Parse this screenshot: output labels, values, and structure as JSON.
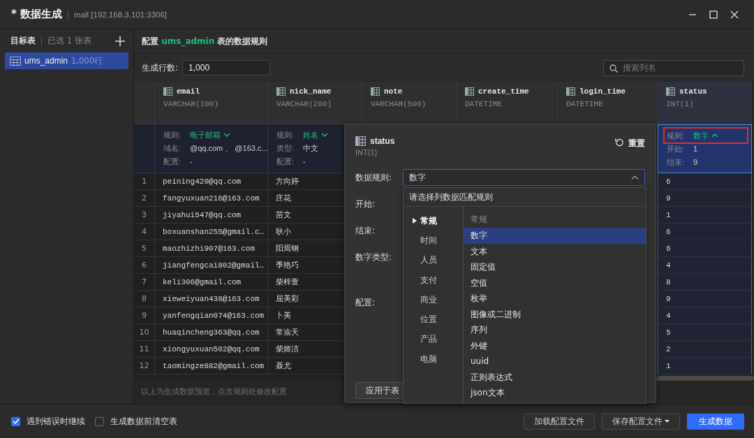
{
  "window": {
    "title": "* 数据生成",
    "connection": "mall [192.168.3.101:3306]"
  },
  "sidebar": {
    "title": "目标表",
    "selected_count": "已选 1 张表",
    "items": [
      {
        "name": "ums_admin",
        "rows": "1,000行",
        "selected": true
      }
    ]
  },
  "main": {
    "heading_prefix": "配置",
    "heading_table": "ums_admin",
    "heading_suffix": "表的数据规则"
  },
  "row_count": {
    "label": "生成行数:",
    "value": "1,000"
  },
  "search": {
    "placeholder": "搜索列名"
  },
  "row_numbers": [
    "1",
    "2",
    "3",
    "4",
    "5",
    "6",
    "7",
    "8",
    "9",
    "10",
    "11",
    "12"
  ],
  "columns": [
    {
      "name": "email",
      "type": "VARCHAR(100)",
      "selected": false,
      "rule": [
        {
          "label": "规则:",
          "value": "电子邮箱",
          "kind": "rule",
          "expanded": false,
          "marked": false
        },
        {
          "label": "域名:",
          "value": "@qq.com 、 @163.c…",
          "kind": "param"
        },
        {
          "label": "配置:",
          "value": "-",
          "kind": "param"
        }
      ],
      "cells": [
        "peining420@qq.com",
        "fangyuxuan216@163.com",
        "jiyahui547@qq.com",
        "boxuanshan255@gmail.c…",
        "maozhizhi907@163.com",
        "jiangfengcai802@gmail…",
        "keli306@gmail.com",
        "xieweiyuan438@163.com",
        "yanfengqian074@163.com",
        "huaqincheng363@qq.com",
        "xiongyuxuan502@qq.com",
        "taomingze882@gmail.com"
      ]
    },
    {
      "name": "nick_name",
      "type": "VARCHAR(200)",
      "selected": false,
      "rule": [
        {
          "label": "规则:",
          "value": "姓名",
          "kind": "rule",
          "expanded": false,
          "marked": false
        },
        {
          "label": "类型:",
          "value": "中文",
          "kind": "param"
        },
        {
          "label": "配置:",
          "value": "-",
          "kind": "param"
        }
      ],
      "cells": [
        "方向婷",
        "庄花",
        "苗文",
        "耿小",
        "阳焉钢",
        "季艳巧",
        "柴梓萱",
        "屈美彩",
        "卜美",
        "常渝天",
        "柴姬洁",
        "聂尤"
      ]
    },
    {
      "name": "note",
      "type": "VARCHAR(500)",
      "selected": false
    },
    {
      "name": "create_time",
      "type": "DATETIME",
      "selected": false
    },
    {
      "name": "login_time",
      "type": "DATETIME",
      "selected": false
    },
    {
      "name": "status",
      "type": "INT(1)",
      "selected": true,
      "rule": [
        {
          "label": "规则:",
          "value": "数字",
          "kind": "rule",
          "expanded": true,
          "marked": true
        },
        {
          "label": "开始:",
          "value": "1",
          "kind": "param"
        },
        {
          "label": "结束:",
          "value": "9",
          "kind": "param"
        }
      ],
      "cells": [
        "6",
        "9",
        "1",
        "6",
        "6",
        "4",
        "8",
        "9",
        "4",
        "5",
        "2",
        "1"
      ]
    }
  ],
  "preview_note": "以上为生成数据预览，点击规则处修改配置",
  "popover": {
    "column": "status",
    "type": "INT(1)",
    "reset": "重置",
    "fields": [
      {
        "label": "数据规则:",
        "kind": "select",
        "value": "数字",
        "expanded": true
      },
      {
        "label": "开始:",
        "kind": "label"
      },
      {
        "label": "结束:",
        "kind": "label"
      },
      {
        "label": "数字类型:",
        "kind": "label"
      },
      {
        "label": "配置:",
        "kind": "label"
      }
    ],
    "apply_button": "应用于表",
    "dropdown": {
      "header": "请选择列数据匹配规则",
      "categories": [
        {
          "label": "常规",
          "selected": true
        },
        {
          "label": "时间",
          "selected": false
        },
        {
          "label": "人员",
          "selected": false
        },
        {
          "label": "支付",
          "selected": false
        },
        {
          "label": "商业",
          "selected": false
        },
        {
          "label": "位置",
          "selected": false
        },
        {
          "label": "产品",
          "selected": false
        },
        {
          "label": "电脑",
          "selected": false
        }
      ],
      "group": "常规",
      "rules": [
        {
          "label": "数字",
          "selected": true
        },
        {
          "label": "文本",
          "selected": false
        },
        {
          "label": "固定值",
          "selected": false
        },
        {
          "label": "空值",
          "selected": false
        },
        {
          "label": "枚举",
          "selected": false
        },
        {
          "label": "图像或二进制",
          "selected": false
        },
        {
          "label": "序列",
          "selected": false
        },
        {
          "label": "外键",
          "selected": false
        },
        {
          "label": "uuid",
          "selected": false
        },
        {
          "label": "正则表达式",
          "selected": false
        },
        {
          "label": "json文本",
          "selected": false
        }
      ]
    }
  },
  "footer": {
    "options": [
      {
        "label": "遇到错误时继续",
        "checked": true
      },
      {
        "label": "生成数据前清空表",
        "checked": false
      }
    ],
    "buttons": [
      {
        "label": "加载配置文件",
        "kind": "default"
      },
      {
        "label": "保存配置文件",
        "kind": "dropdown"
      },
      {
        "label": "生成数据",
        "kind": "primary"
      }
    ]
  }
}
